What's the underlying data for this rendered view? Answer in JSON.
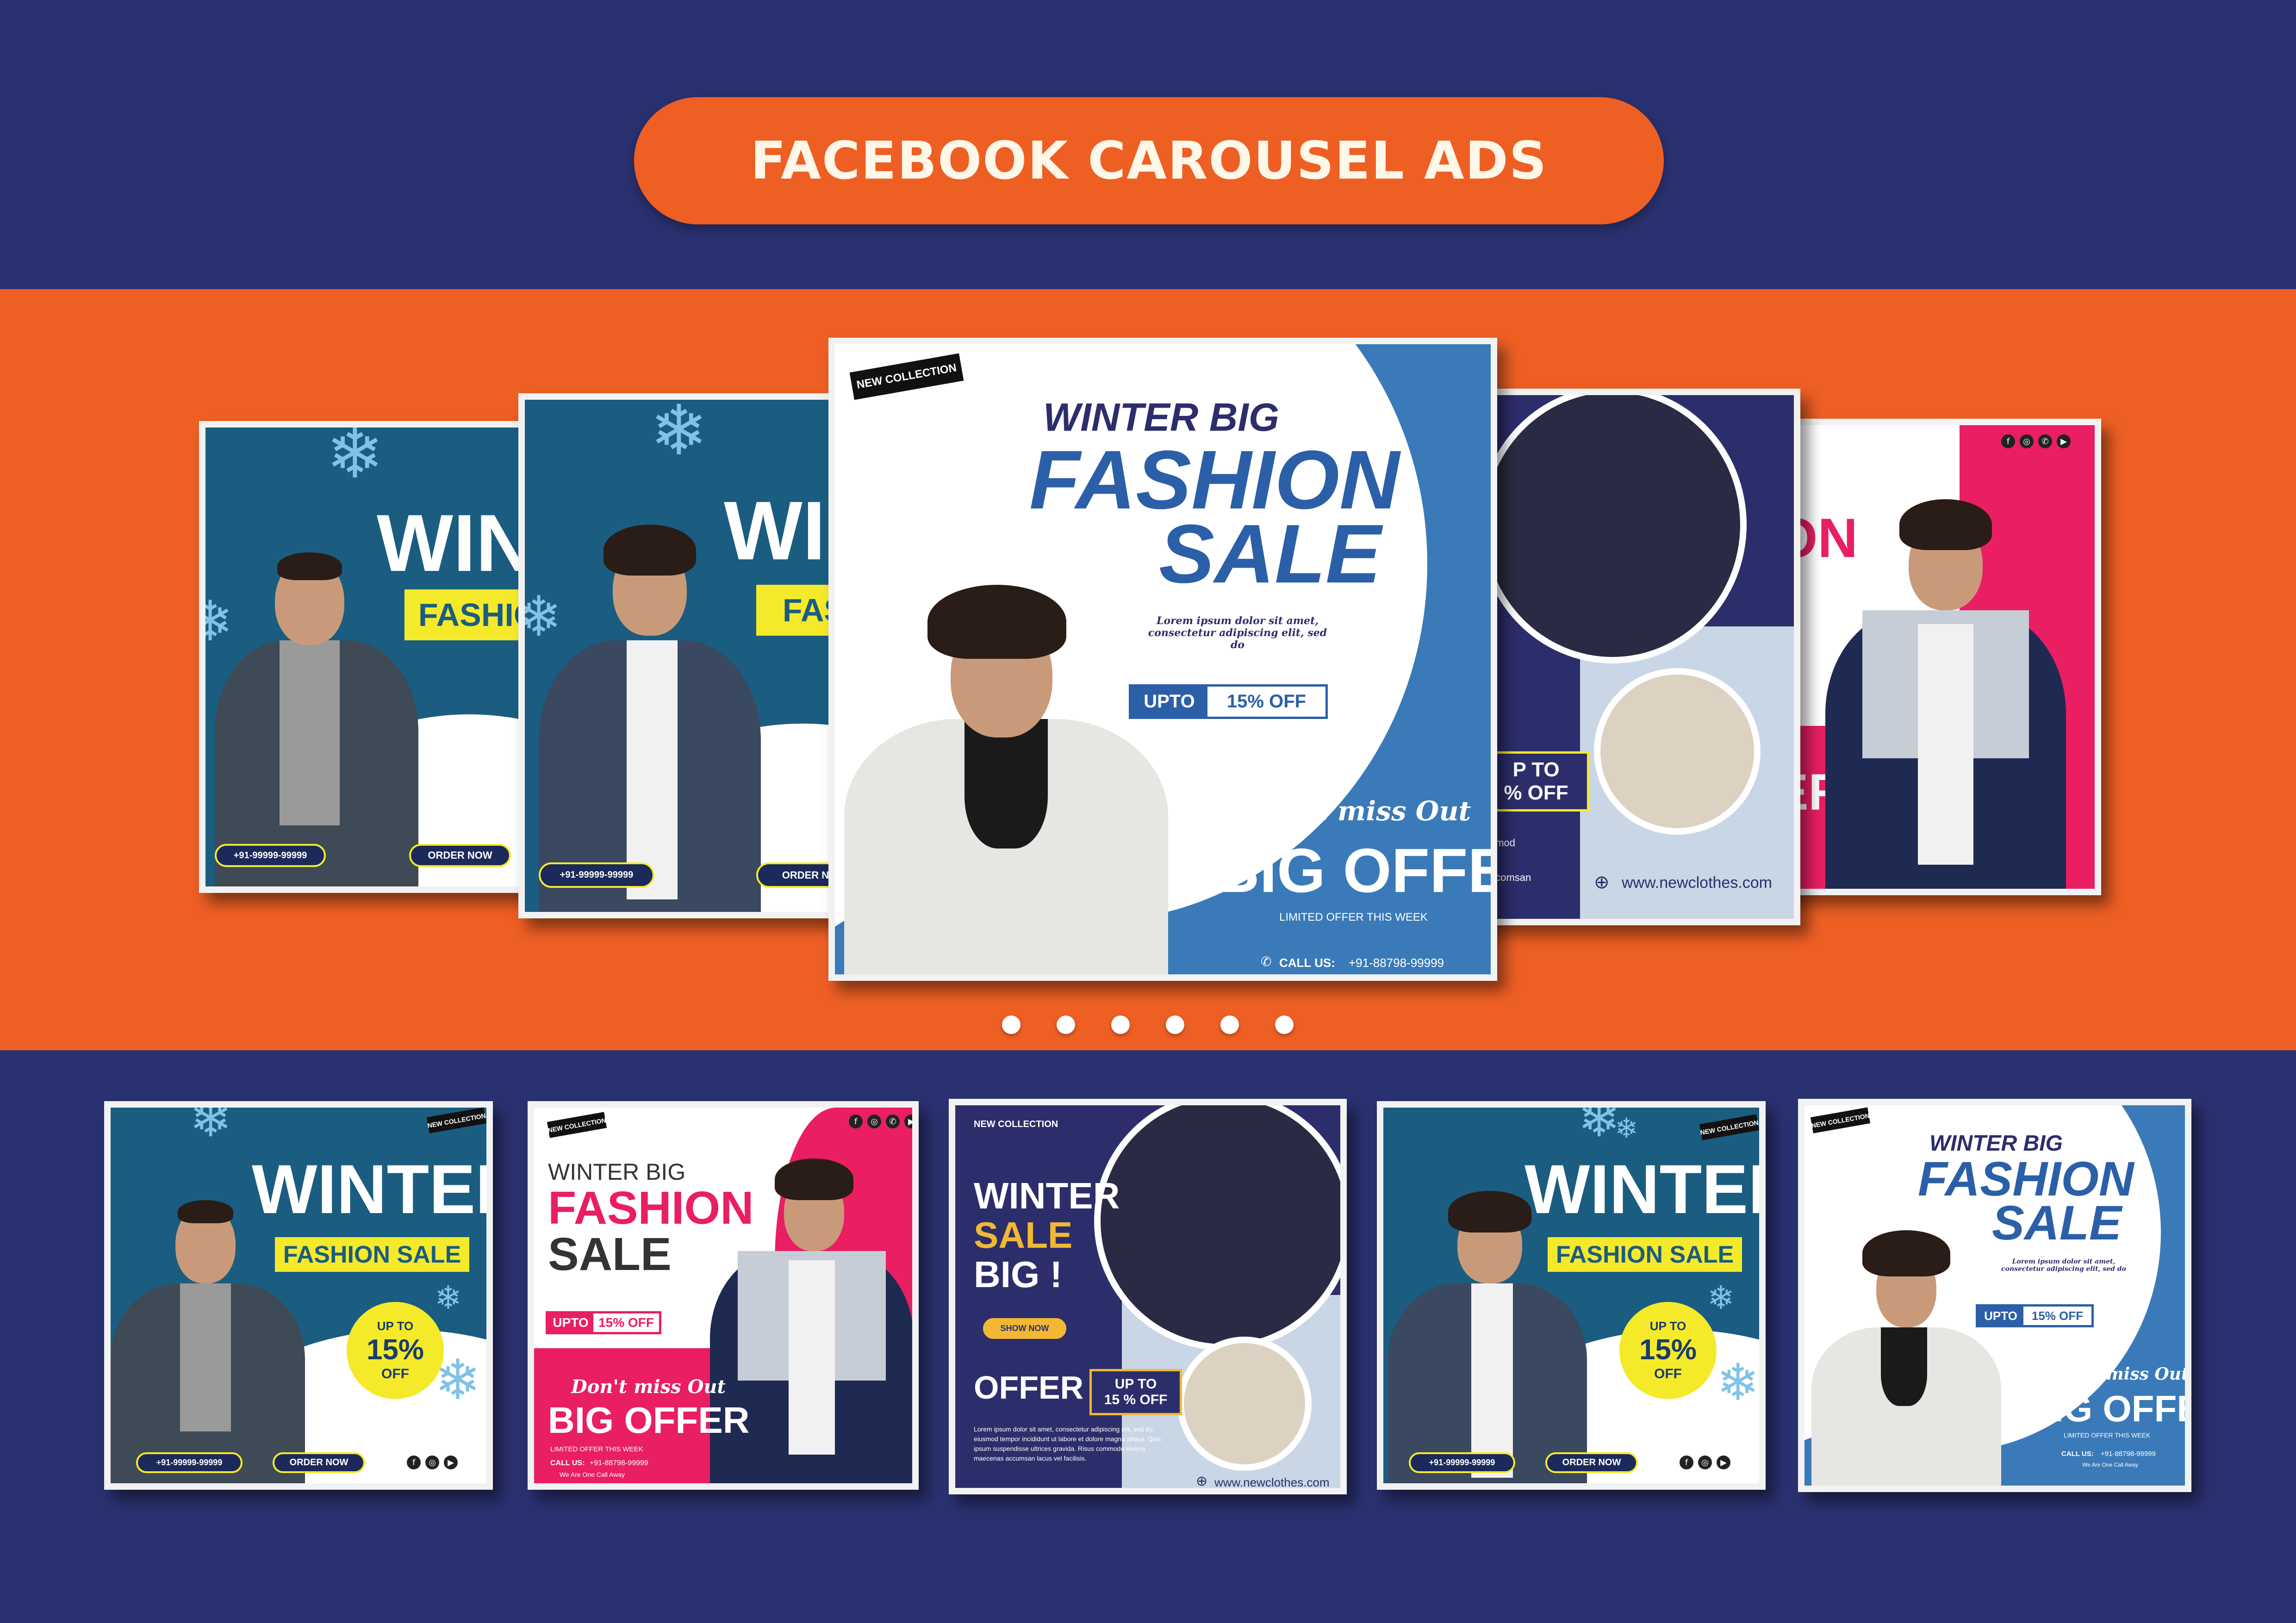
{
  "title": "FACEBOOK CAROUSEL ADS",
  "colors": {
    "navy": "#2a3170",
    "orange": "#ee5f24",
    "teal": "#1a5d80",
    "blue": "#3a7ab8",
    "pink": "#e91e63",
    "yellow": "#f5ea2a"
  },
  "carousel": {
    "dots_count": 6,
    "main": {
      "tag": "NEW COLLECTION",
      "line1": "WINTER BIG",
      "line2": "FASHION",
      "line3": "SALE",
      "lorem": "Lorem ipsum dolor sit amet, consectetur adipiscing elit, sed do",
      "upto": "UPTO",
      "off": "15% OFF",
      "dont": "Don't miss Out",
      "big_offer": "BIG OFFER",
      "limited": "LIMITED OFFER THIS WEEK",
      "call": "CALL US:",
      "phone": "+91-88798-99999"
    },
    "left1": {
      "winter": "WIN",
      "fashion": "FASHIO",
      "phone": "+91-99999-99999",
      "order": "ORDER NOW"
    },
    "left2": {
      "winter": "WI",
      "fashion": "FAS",
      "phone": "+91-99999-99999",
      "order": "ORDER NO"
    },
    "right1": {
      "upto": "P TO",
      "off": "% OFF",
      "web": "www.newclothes.com",
      "s1": "amod",
      "s2": "ecomsan"
    },
    "right2": {
      "sale": "ON",
      "big": "ER"
    }
  },
  "cards": [
    {
      "winter": "WINTER",
      "fashion": "FASHION SALE",
      "upto": "UP TO",
      "pct": "15%",
      "off": "OFF",
      "phone": "+91-99999-99999",
      "order": "ORDER NOW",
      "tag": "NEW COLLECTION"
    },
    {
      "tag": "NEW COLLECTION",
      "line1": "WINTER BIG",
      "line2": "FASHION",
      "line3": "SALE",
      "upto": "UPTO",
      "off": "15% OFF",
      "dont": "Don't miss Out",
      "big_offer": "BIG OFFER",
      "limited": "LIMITED OFFER THIS WEEK",
      "call": "CALL US:",
      "phone": "+91-88798-99999",
      "call2": "We Are One Call Away"
    },
    {
      "collection": "NEW COLLECTION",
      "winter": "WINTER",
      "sale": "SALE",
      "big": "BIG !",
      "shop": "SHOW NOW",
      "offer": "OFFER !",
      "upto": "UP TO",
      "off": "15 %  OFF",
      "lorem": "Lorem ipsum dolor sit amet, consectetur adipiscing elit, sed do eiusmod tempor incididunt ut labore et dolore magna aliqua. Quis ipsum suspendisse ultrices gravida. Risus commodo viverra maecenas accumsan lacus vel facilisis.",
      "web": "www.newclothes.com"
    },
    {
      "winter": "WINTER",
      "fashion": "FASHION SALE",
      "upto": "UP TO",
      "pct": "15%",
      "off": "OFF",
      "phone": "+91-99999-99999",
      "order": "ORDER NOW",
      "tag": "NEW COLLECTION"
    },
    {
      "tag": "NEW COLLECTION",
      "line1": "WINTER BIG",
      "line2": "FASHION",
      "line3": "SALE",
      "lorem": "Lorem ipsum dolor sit amet, consectetur adipiscing elit, sed do",
      "upto": "UPTO",
      "off": "15% OFF",
      "dont": "Don't miss Out",
      "big_offer": "BIG OFFER",
      "limited": "LIMITED OFFER THIS WEEK",
      "call": "CALL US:",
      "phone": "+91-88798-99999",
      "call2": "We Are One Call Away"
    }
  ]
}
